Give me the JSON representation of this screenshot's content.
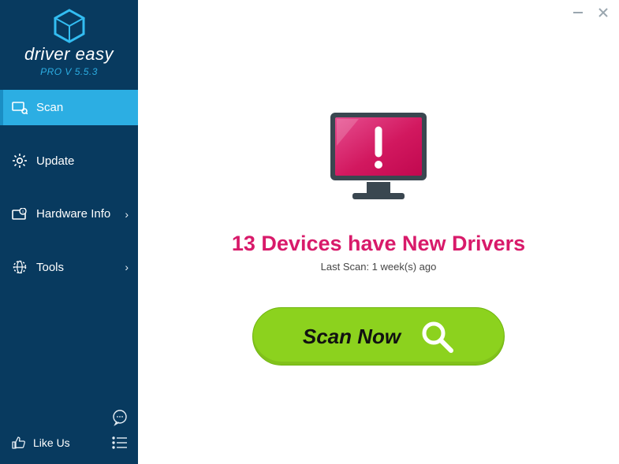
{
  "brand": {
    "name": "driver easy",
    "version_line": "PRO V 5.5.3"
  },
  "sidebar": {
    "items": [
      {
        "label": "Scan",
        "icon": "scan-icon",
        "has_chevron": false
      },
      {
        "label": "Update",
        "icon": "gear-icon",
        "has_chevron": false
      },
      {
        "label": "Hardware Info",
        "icon": "hardware-icon",
        "has_chevron": true
      },
      {
        "label": "Tools",
        "icon": "globe-icon",
        "has_chevron": true
      }
    ],
    "like_label": "Like Us"
  },
  "main": {
    "headline": "13 Devices have New Drivers",
    "last_scan": "Last Scan: 1 week(s) ago",
    "scan_button": "Scan Now"
  },
  "colors": {
    "sidebar_bg": "#083a5f",
    "sidebar_active": "#2caee3",
    "headline": "#d81a6a",
    "scan_btn": "#8cd21e",
    "monitor_screen": "#d2185f"
  }
}
